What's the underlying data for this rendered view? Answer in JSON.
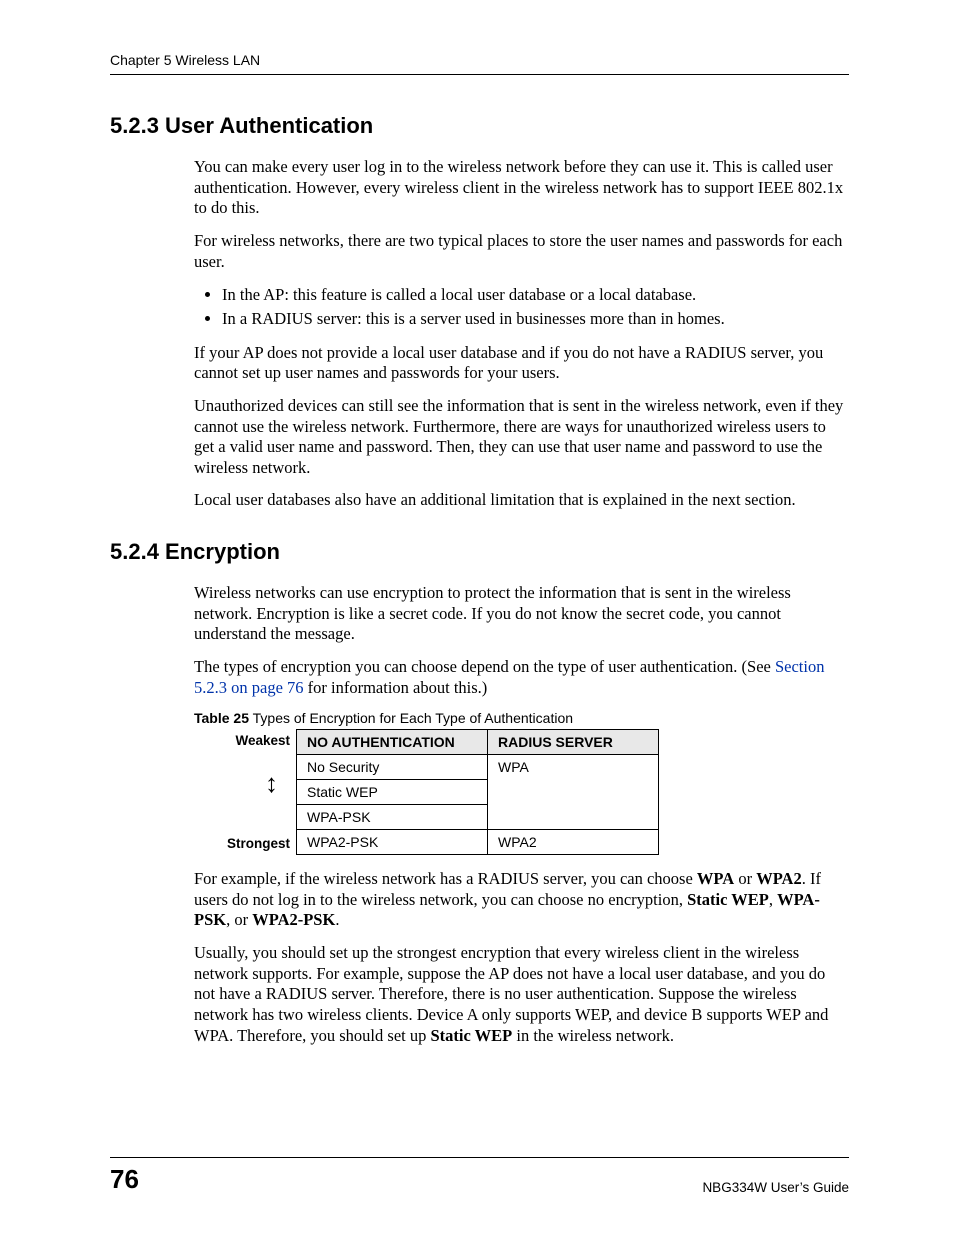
{
  "header": {
    "chapter": "Chapter 5 Wireless LAN"
  },
  "section523": {
    "heading": "5.2.3  User Authentication",
    "p1": "You can make every user log in to the wireless network before they can use it. This is called user authentication. However, every wireless client in the wireless network has to support IEEE 802.1x to do this.",
    "p2": "For wireless networks, there are two typical places to store the user names and passwords for each user.",
    "bullets": [
      "In the AP: this feature is called a local user database or a local database.",
      "In a RADIUS server: this is a server used in businesses more than in homes."
    ],
    "p3": "If your AP does not provide a local user database and if you do not have a RADIUS server, you cannot set up user names and passwords for your users.",
    "p4": "Unauthorized devices can still see the information that is sent in the wireless network, even if they cannot use the wireless network. Furthermore, there are ways for unauthorized wireless users to get a valid user name and password. Then, they can use that user name and password to use the wireless network.",
    "p5": "Local user databases also have an additional limitation that is explained in the next section."
  },
  "section524": {
    "heading": "5.2.4  Encryption",
    "p1": "Wireless networks can use encryption to protect the information that is sent in the wireless network. Encryption is like a secret code. If you do not know the secret code, you cannot understand the message.",
    "p2_pre": "The types of encryption you can choose depend on the type of user authentication. (See ",
    "p2_link": "Section 5.2.3 on page 76",
    "p2_post": " for information about this.)",
    "table_caption_bold": "Table 25",
    "table_caption_rest": "   Types of Encryption for Each Type of Authentication",
    "row_label_top": "Weakest",
    "row_label_bottom": "Strongest",
    "th1": "NO AUTHENTICATION",
    "th2": "RADIUS SERVER",
    "r1c1": "No Security",
    "r1c2": "WPA",
    "r2c1": "Static WEP",
    "r3c1": "WPA-PSK",
    "r4c1": "WPA2-PSK",
    "r4c2": "WPA2",
    "p3_a": "For example, if the wireless network has a RADIUS server, you can choose ",
    "p3_b1": "WPA",
    "p3_c": " or ",
    "p3_b2": "WPA2",
    "p3_d": ". If users do not log in to the wireless network, you can choose no encryption, ",
    "p3_b3": "Static WEP",
    "p3_e": ", ",
    "p3_b4": "WPA-PSK",
    "p3_f": ", or ",
    "p3_b5": "WPA2-PSK",
    "p3_g": ".",
    "p4_a": "Usually, you should set up the strongest encryption that every wireless client in the wireless network supports. For example, suppose the AP does not have a local user database, and you do not have a RADIUS server. Therefore, there is no user authentication. Suppose the wireless network has two wireless clients. Device A only supports WEP, and device B supports WEP and WPA. Therefore, you should set up ",
    "p4_b": "Static WEP",
    "p4_c": " in the wireless network."
  },
  "footer": {
    "page": "76",
    "guide": "NBG334W User’s Guide"
  }
}
